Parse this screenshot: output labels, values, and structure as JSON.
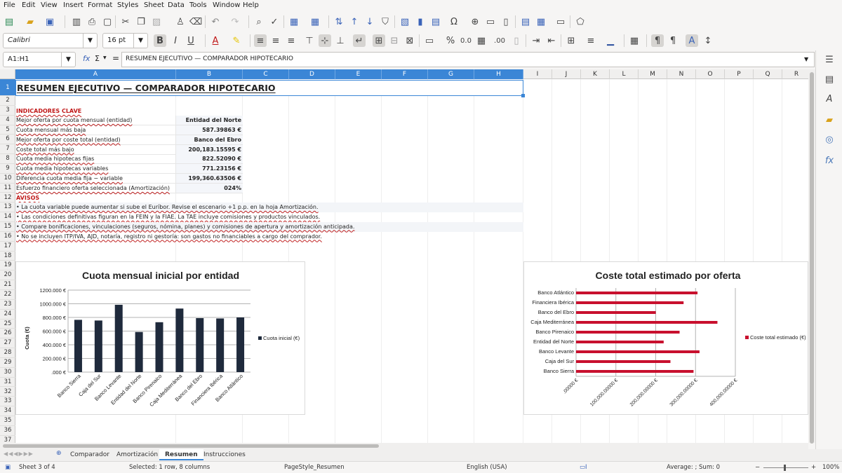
{
  "menu": [
    "File",
    "Edit",
    "View",
    "Insert",
    "Format",
    "Styles",
    "Sheet",
    "Data",
    "Tools",
    "Window",
    "Help"
  ],
  "format_toolbar": {
    "font_name": "Calibri",
    "font_size": "16 pt"
  },
  "formula_bar": {
    "name_box": "A1:H1",
    "fx_symbol": "fx",
    "sigma_symbol": "Σ",
    "equals_symbol": "=",
    "content": "RESUMEN EJECUTIVO — COMPARADOR HIPOTECARIO"
  },
  "columns": [
    "A",
    "B",
    "C",
    "D",
    "E",
    "F",
    "G",
    "H",
    "I",
    "J",
    "K",
    "L",
    "M",
    "N",
    "O",
    "P",
    "Q",
    "R"
  ],
  "rows": [
    "1",
    "2",
    "3",
    "4",
    "5",
    "6",
    "7",
    "8",
    "9",
    "10",
    "11",
    "12",
    "13",
    "14",
    "15",
    "16",
    "17",
    "18",
    "19",
    "20",
    "21",
    "22",
    "23",
    "24",
    "25",
    "26",
    "27",
    "28",
    "29",
    "30",
    "31",
    "32",
    "33",
    "34",
    "35",
    "36",
    "37"
  ],
  "sheet": {
    "title": "RESUMEN EJECUTIVO — COMPARADOR HIPOTECARIO",
    "section_kpis": "INDICADORES CLAVE",
    "kpis": [
      {
        "label": "Mejor oferta por cuota mensual (entidad)",
        "value": "Entidad del Norte"
      },
      {
        "label": "Cuota mensual más baja",
        "value": "587.39863 €"
      },
      {
        "label": "Mejor oferta por coste total (entidad)",
        "value": "Banco del Ebro"
      },
      {
        "label": "Coste total más bajo",
        "value": "200,183.15595 €"
      },
      {
        "label": "Cuota media hipotecas fijas",
        "value": "822.52090 €"
      },
      {
        "label": "Cuota media hipotecas variables",
        "value": "771.23156 €"
      },
      {
        "label": "Diferencia cuota media fija − variable",
        "value": "199,360.63506 €"
      },
      {
        "label": "Esfuerzo financiero oferta seleccionada (Amortización)",
        "value": "024%"
      }
    ],
    "section_avisos": "AVISOS",
    "avisos": [
      "• La cuota variable puede aumentar si sube el Euríbor. Revise el escenario +1 p.p. en la hoja Amortización.",
      "• Las condiciones definitivas figuran en la FEIN y la FIAE. La TAE incluye comisiones y productos vinculados.",
      "• Compare bonificaciones, vinculaciones (seguros, nómina, planes) y comisiones de apertura y amortización anticipada.",
      "• No se incluyen ITP/IVA, AJD, notaría, registro ni gestoría: son gastos no financiables a cargo del comprador."
    ]
  },
  "chart_data": [
    {
      "type": "bar",
      "title": "Cuota mensual inicial por entidad",
      "ylabel": "Cuota (€)",
      "xlabel": "",
      "categories": [
        "Banco Sierra",
        "Caja del Sur",
        "Banco Levante",
        "Entidad del Norte",
        "Banco Pirenaico",
        "Caja Mediterránea",
        "Banco del Ebro",
        "Financiera Ibérica",
        "Banco Atlántico"
      ],
      "series": [
        {
          "name": "Cuota inicial (€)",
          "values": [
            765,
            755,
            985,
            587,
            730,
            930,
            790,
            785,
            800
          ]
        }
      ],
      "yticks": [
        ".000 €",
        "200.000 €",
        "400.000 €",
        "600.000 €",
        "800.000 €",
        "1000.000 €",
        "1200.000 €"
      ],
      "ylim": [
        0,
        1200
      ],
      "grid": true,
      "legend": "right",
      "color": "#1f2a3c"
    },
    {
      "type": "bar",
      "orientation": "horizontal",
      "title": "Coste total estimado por oferta",
      "xlabel": "",
      "ylabel": "",
      "categories": [
        "Banco Atlántico",
        "Financiera Ibérica",
        "Banco del Ebro",
        "Caja Mediterránea",
        "Banco Pirenaico",
        "Entidad del Norte",
        "Banco Levante",
        "Caja del Sur",
        "Banco Sierra"
      ],
      "series": [
        {
          "name": "Coste total estimado (€)",
          "values": [
            305000,
            270000,
            200183,
            355000,
            260000,
            220000,
            310000,
            237000,
            295000
          ]
        }
      ],
      "xticks": [
        ".00000 €",
        "100,000.00000 €",
        "200,000.00000 €",
        "300,000.00000 €",
        "400,000.00000 €"
      ],
      "xlim": [
        0,
        400000
      ],
      "grid": true,
      "legend": "right",
      "color": "#c8102e"
    }
  ],
  "sheet_tabs": [
    "Comparador",
    "Amortización",
    "Resumen",
    "Instrucciones"
  ],
  "active_tab": "Resumen",
  "status": {
    "sheet": "Sheet 3 of 4",
    "selection": "Selected: 1 row, 8 columns",
    "page_style": "PageStyle_Resumen",
    "language": "English (USA)",
    "sum": "Average: ; Sum: 0",
    "zoom": "100%"
  }
}
